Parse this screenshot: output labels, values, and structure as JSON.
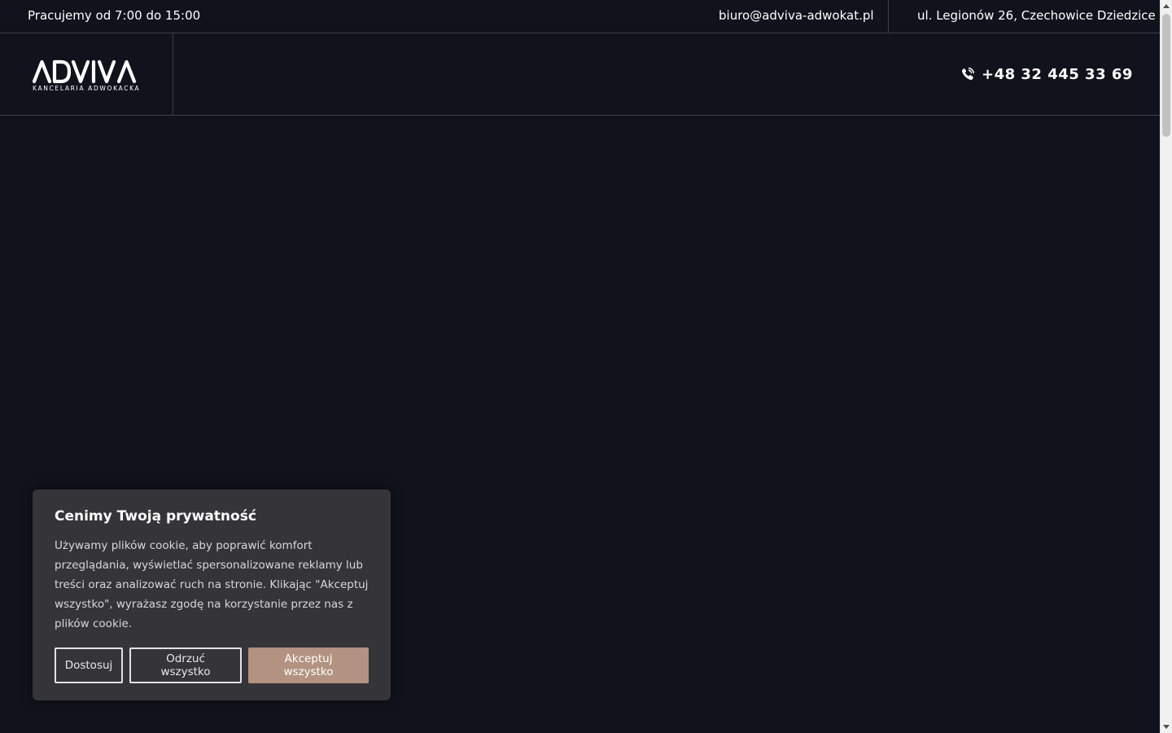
{
  "topbar": {
    "hours": "Pracujemy od 7:00 do 15:00",
    "email": "biuro@adviva-adwokat.pl",
    "address": "ul. Legionów 26, Czechowice Dziedzice"
  },
  "header": {
    "logo": {
      "name": "ADVIVA",
      "tagline": "KANCELARIA ADWOKACKA"
    },
    "phone": "+48 32 445 33 69"
  },
  "cookie_banner": {
    "title": "Cenimy Twoją prywatność",
    "text": "Używamy plików cookie, aby poprawić komfort przeglądania, wyświetlać spersonalizowane reklamy lub treści oraz analizować ruch na stronie. Klikając \"Akceptuj wszystko\", wyrażasz zgodę na korzystanie przez nas z plików cookie.",
    "buttons": {
      "customize": "Dostosuj",
      "reject": "Odrzuć wszystko",
      "accept": "Akceptuj wszystko"
    }
  },
  "colors": {
    "background": "#10131b",
    "banner_bg": "#353439",
    "accent": "#b39281",
    "border": "#3a3e46"
  },
  "icons": {
    "phone": "phone-icon"
  }
}
